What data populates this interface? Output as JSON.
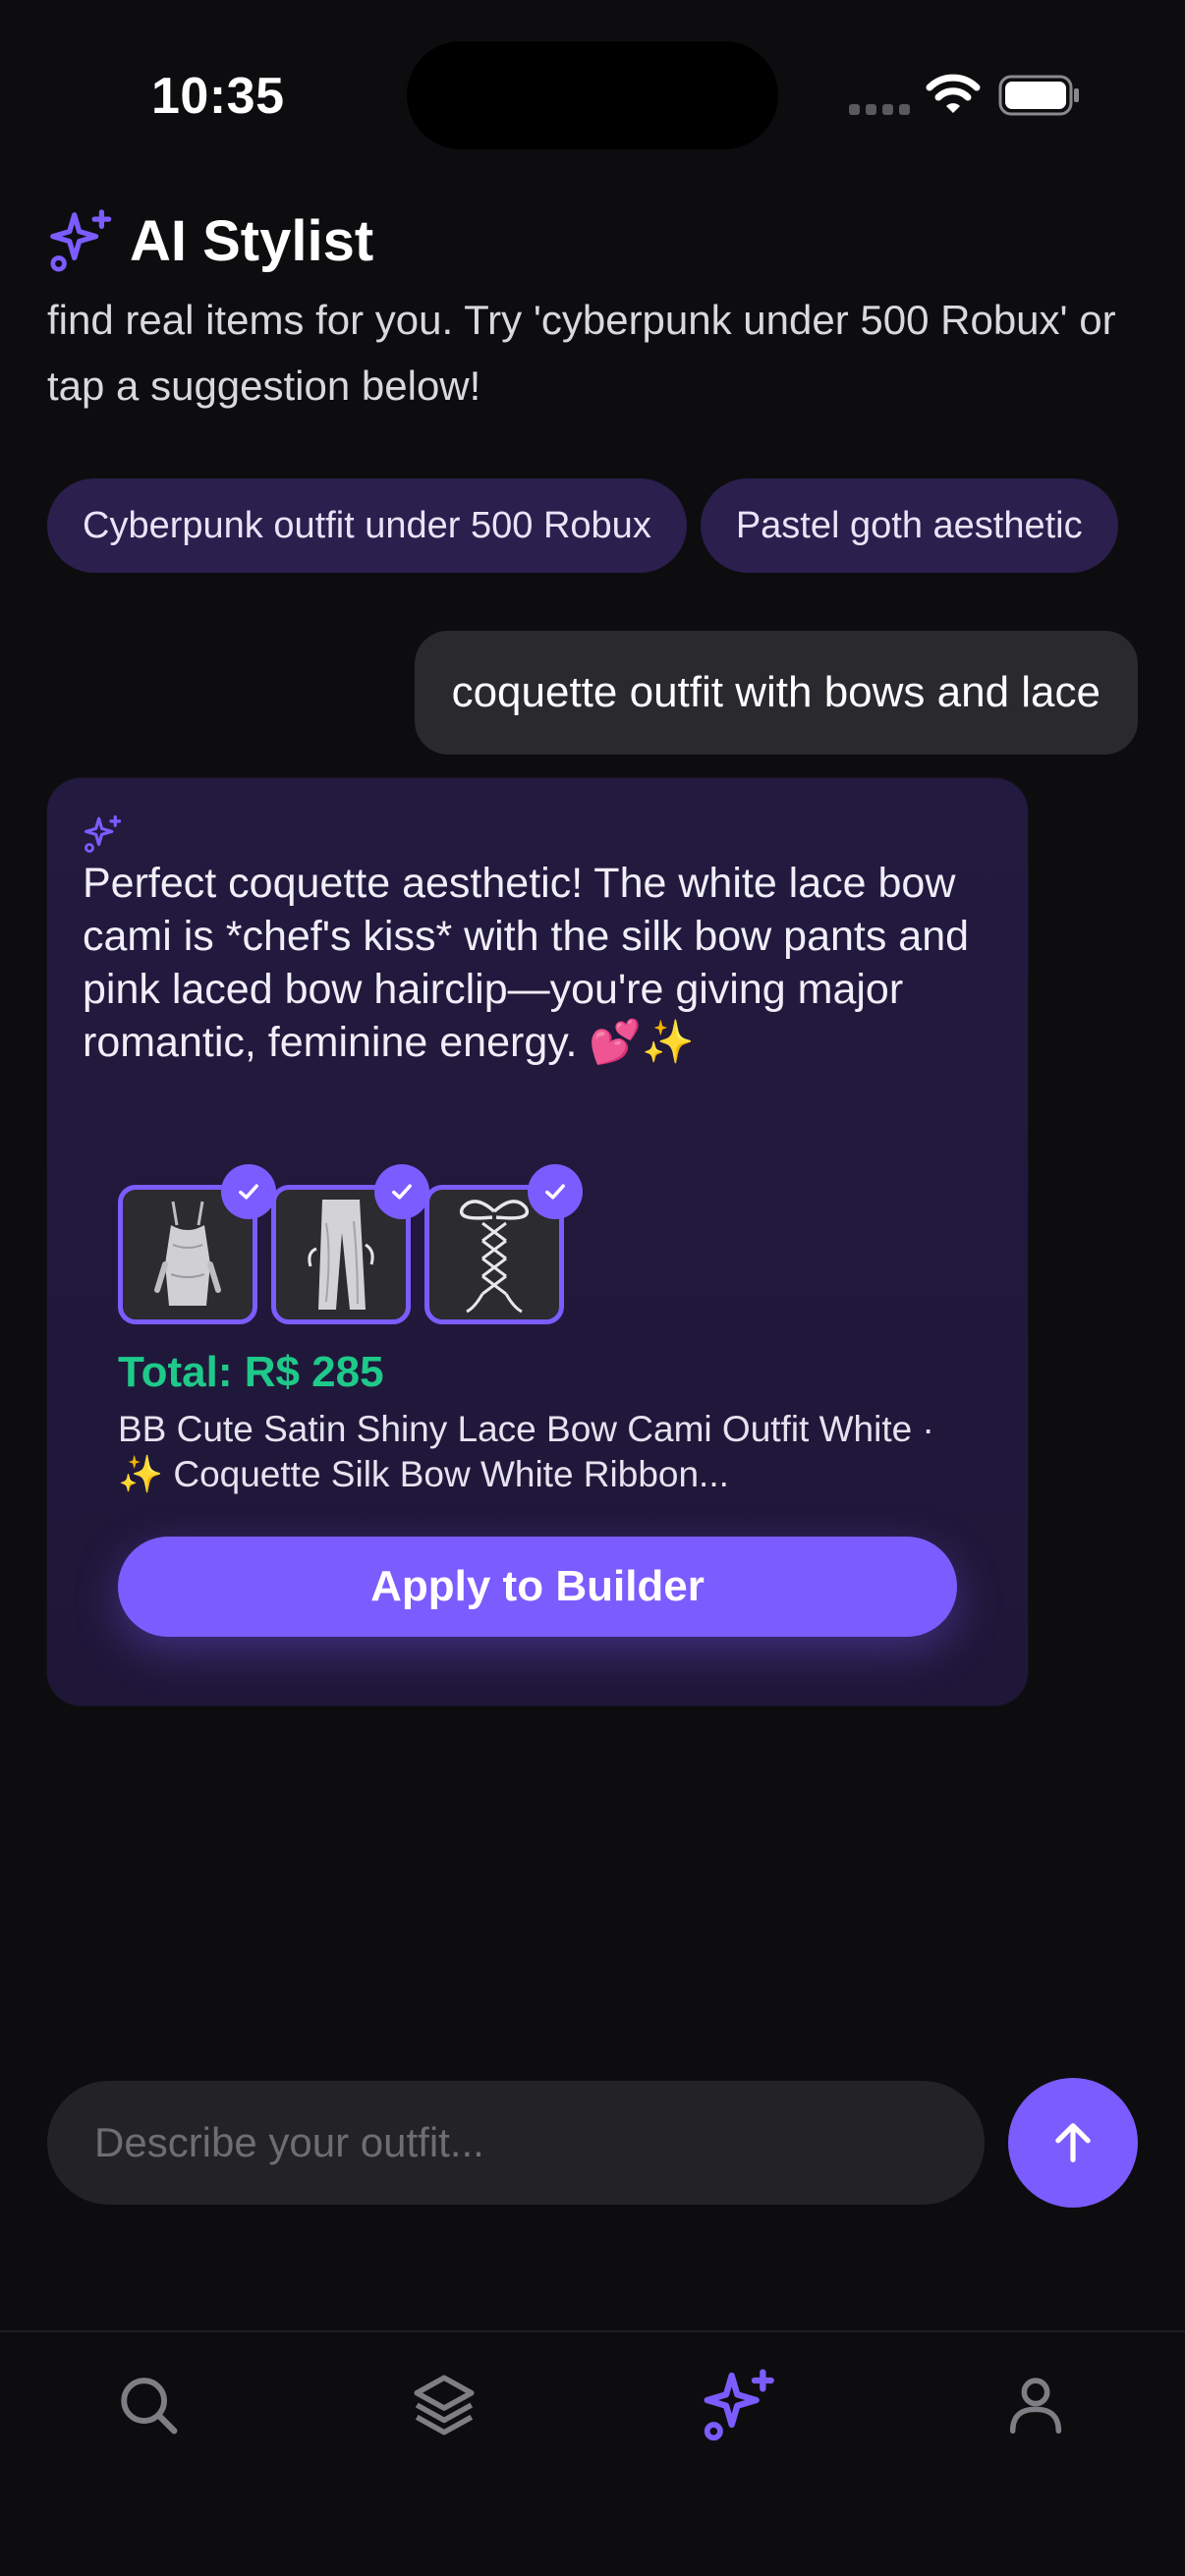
{
  "status_bar": {
    "time": "10:35"
  },
  "header": {
    "title": "AI Stylist"
  },
  "intro": {
    "text": "find real items for you. Try 'cyberpunk under 500 Robux' or tap a suggestion below!"
  },
  "suggestions": [
    "Cyberpunk outfit under 500 Robux",
    "Pastel goth aesthetic"
  ],
  "user_message": {
    "text": "coquette outfit with bows and lace"
  },
  "ai_response": {
    "text": "Perfect coquette aesthetic! The white lace bow cami is *chef's kiss* with the silk bow pants and pink laced bow hairclip—you're giving major romantic, feminine energy. 💕✨",
    "items": [
      {
        "icon": "cami-outfit-thumbnail",
        "selected": true
      },
      {
        "icon": "silk-pants-thumbnail",
        "selected": true
      },
      {
        "icon": "laced-bow-hairclip-thumbnail",
        "selected": true
      }
    ],
    "total_label": "Total: R$ 285",
    "items_summary": "BB Cute Satin Shiny Lace Bow Cami Outfit White · ✨ Coquette Silk Bow White Ribbon...",
    "apply_label": "Apply to Builder"
  },
  "composer": {
    "placeholder": "Describe your outfit..."
  },
  "tab_bar": {
    "tabs": [
      {
        "icon": "search-icon",
        "active": false
      },
      {
        "icon": "layers-icon",
        "active": false
      },
      {
        "icon": "sparkles-icon",
        "active": true
      },
      {
        "icon": "profile-icon",
        "active": false
      }
    ]
  },
  "colors": {
    "accent": "#7b5cff",
    "background": "#0d0d0f",
    "card": "#231a3f",
    "chip": "#2a1f4d",
    "price": "#1ec98a"
  }
}
